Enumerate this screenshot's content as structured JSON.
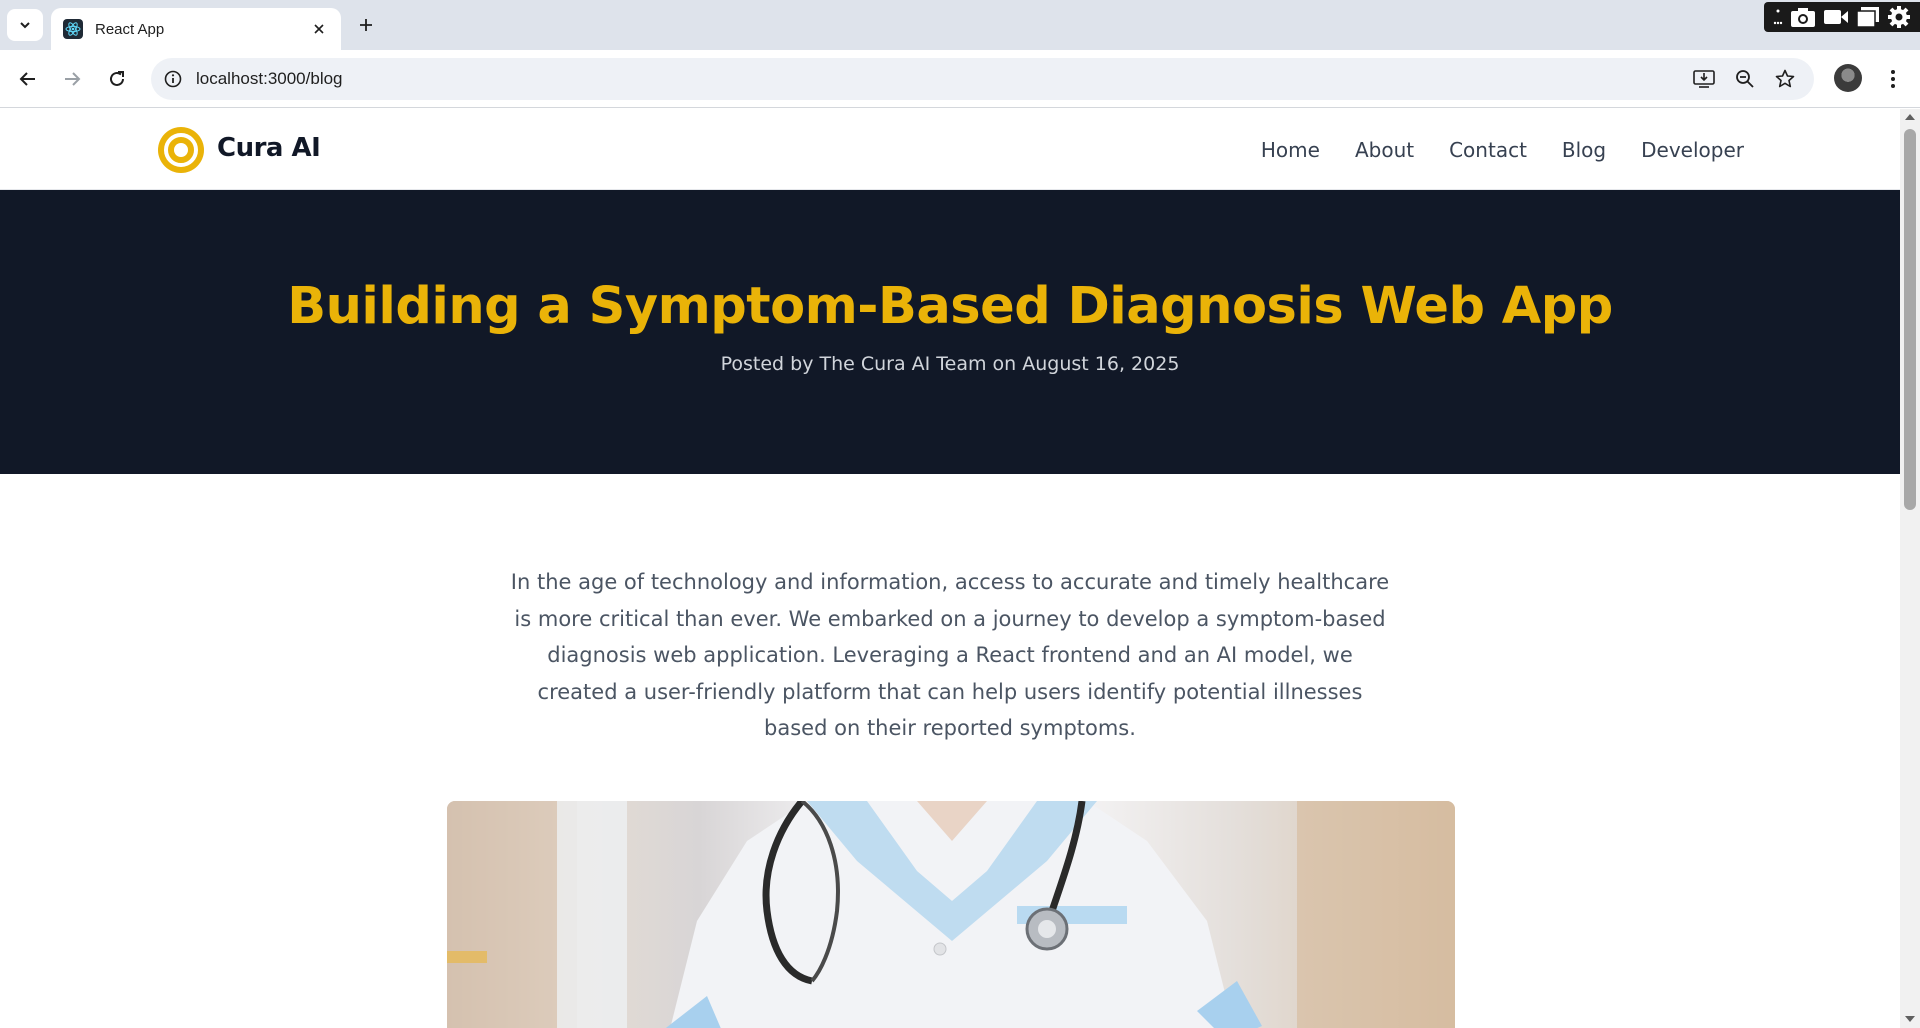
{
  "browser": {
    "tab_title": "React App",
    "url": "localhost:3000/blog"
  },
  "site": {
    "brand": "Cura AI",
    "nav": [
      "Home",
      "About",
      "Contact",
      "Blog",
      "Developer"
    ],
    "accent_color": "#eab308",
    "hero_bg": "#111827"
  },
  "post": {
    "title": "Building a Symptom-Based Diagnosis Web App",
    "meta": "Posted by The Cura AI Team on August 16, 2025",
    "intro": "In the age of technology and information, access to accurate and timely healthcare is more critical than ever. We embarked on a journey to develop a symptom-based diagnosis web application. Leveraging a React frontend and an AI model, we created a user-friendly platform that can help users identify potential illnesses based on their reported symptoms.",
    "image_icon": "doctor-photo"
  }
}
